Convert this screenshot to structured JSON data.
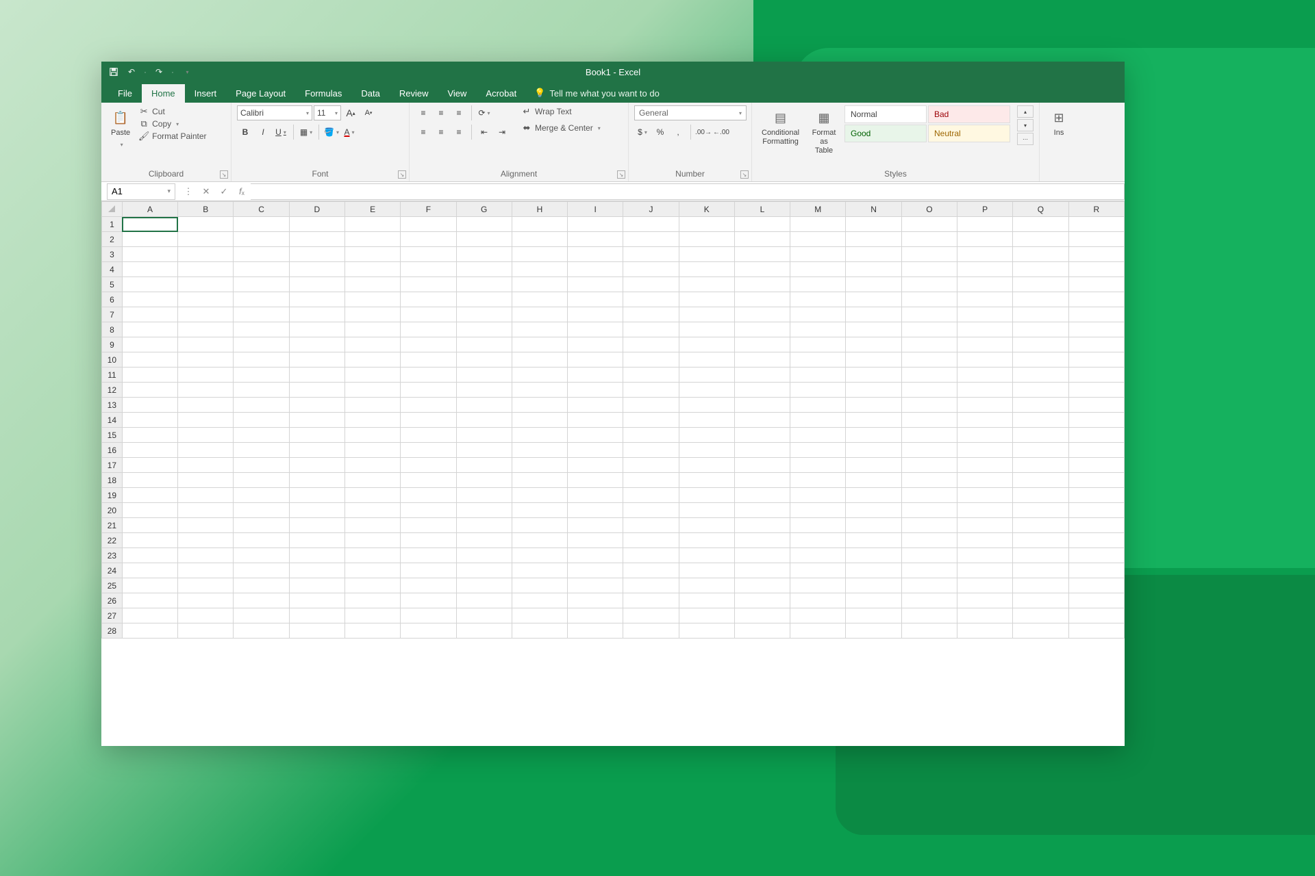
{
  "app_title": "Book1 - Excel",
  "qat": {
    "save": "save",
    "undo": "undo",
    "redo": "redo"
  },
  "tabs": [
    "File",
    "Home",
    "Insert",
    "Page Layout",
    "Formulas",
    "Data",
    "Review",
    "View",
    "Acrobat"
  ],
  "active_tab": "Home",
  "tellme": "Tell me what you want to do",
  "ribbon": {
    "clipboard": {
      "label": "Clipboard",
      "paste": "Paste",
      "cut": "Cut",
      "copy": "Copy",
      "format_painter": "Format Painter"
    },
    "font": {
      "label": "Font",
      "family": "Calibri",
      "size": "11",
      "bold": "B",
      "italic": "I",
      "underline": "U",
      "grow": "A",
      "shrink": "A"
    },
    "alignment": {
      "label": "Alignment",
      "wrap": "Wrap Text",
      "merge": "Merge & Center"
    },
    "number": {
      "label": "Number",
      "format": "General"
    },
    "styles": {
      "label": "Styles",
      "conditional": "Conditional Formatting",
      "format_table": "Format as Table",
      "normal": "Normal",
      "bad": "Bad",
      "good": "Good",
      "neutral": "Neutral"
    },
    "cells": {
      "label": "",
      "insert": "Ins"
    }
  },
  "formula_bar": {
    "namebox": "A1",
    "formula": ""
  },
  "grid": {
    "columns": [
      "A",
      "B",
      "C",
      "D",
      "E",
      "F",
      "G",
      "H",
      "I",
      "J",
      "K",
      "L",
      "M",
      "N",
      "O",
      "P",
      "Q",
      "R"
    ],
    "rows": 28,
    "active_cell": "A1"
  }
}
